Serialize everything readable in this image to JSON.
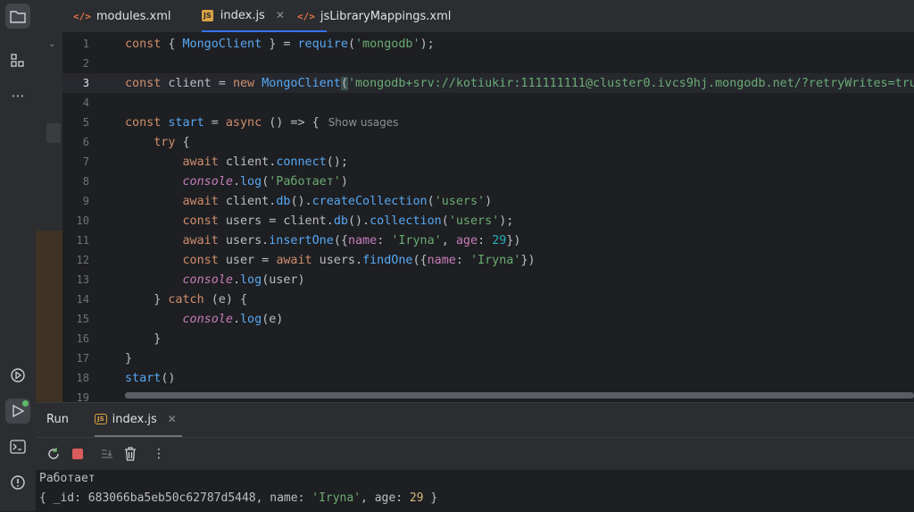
{
  "tabs": [
    {
      "label": "modules.xml",
      "icon": "xml-icon"
    },
    {
      "label": "index.js",
      "icon": "js-file-icon",
      "active": true
    },
    {
      "label": "jsLibraryMappings.xml",
      "icon": "xml-icon"
    }
  ],
  "editor": {
    "line_numbers": [
      "1",
      "2",
      "3",
      "4",
      "5",
      "6",
      "7",
      "8",
      "9",
      "10",
      "11",
      "12",
      "13",
      "14",
      "15",
      "16",
      "17",
      "18",
      "19"
    ],
    "show_usages": "Show usages",
    "lines": [
      "const { MongoClient } = require('mongodb');",
      "",
      "const client = new MongoClient('mongodb+srv://kotiukir:111111111@cluster0.ivcs9hj.mongodb.net/?retryWrites=tru",
      "",
      "const start = async () => {",
      "    try {",
      "        await client.connect();",
      "        console.log('Работает')",
      "        await client.db().createCollection('users')",
      "        const users = client.db().collection('users');",
      "        await users.insertOne({name: 'Iryna', age: 29})",
      "        const user = await users.findOne({name: 'Iryna'})",
      "        console.log(user)",
      "    } catch (e) {",
      "        console.log(e)",
      "    }",
      "}",
      "start()",
      ""
    ]
  },
  "run": {
    "title": "Run",
    "tab_label": "index.js",
    "console": [
      "Работает",
      "{ _id: 683066ba5eb50c62787d5448, name: 'Iryna', age: 29 }"
    ]
  },
  "colors": {
    "accent": "#3574f0",
    "keyword": "#cf8e6d",
    "string": "#6aab73",
    "function": "#56a8f5",
    "number": "#2aacb8"
  }
}
